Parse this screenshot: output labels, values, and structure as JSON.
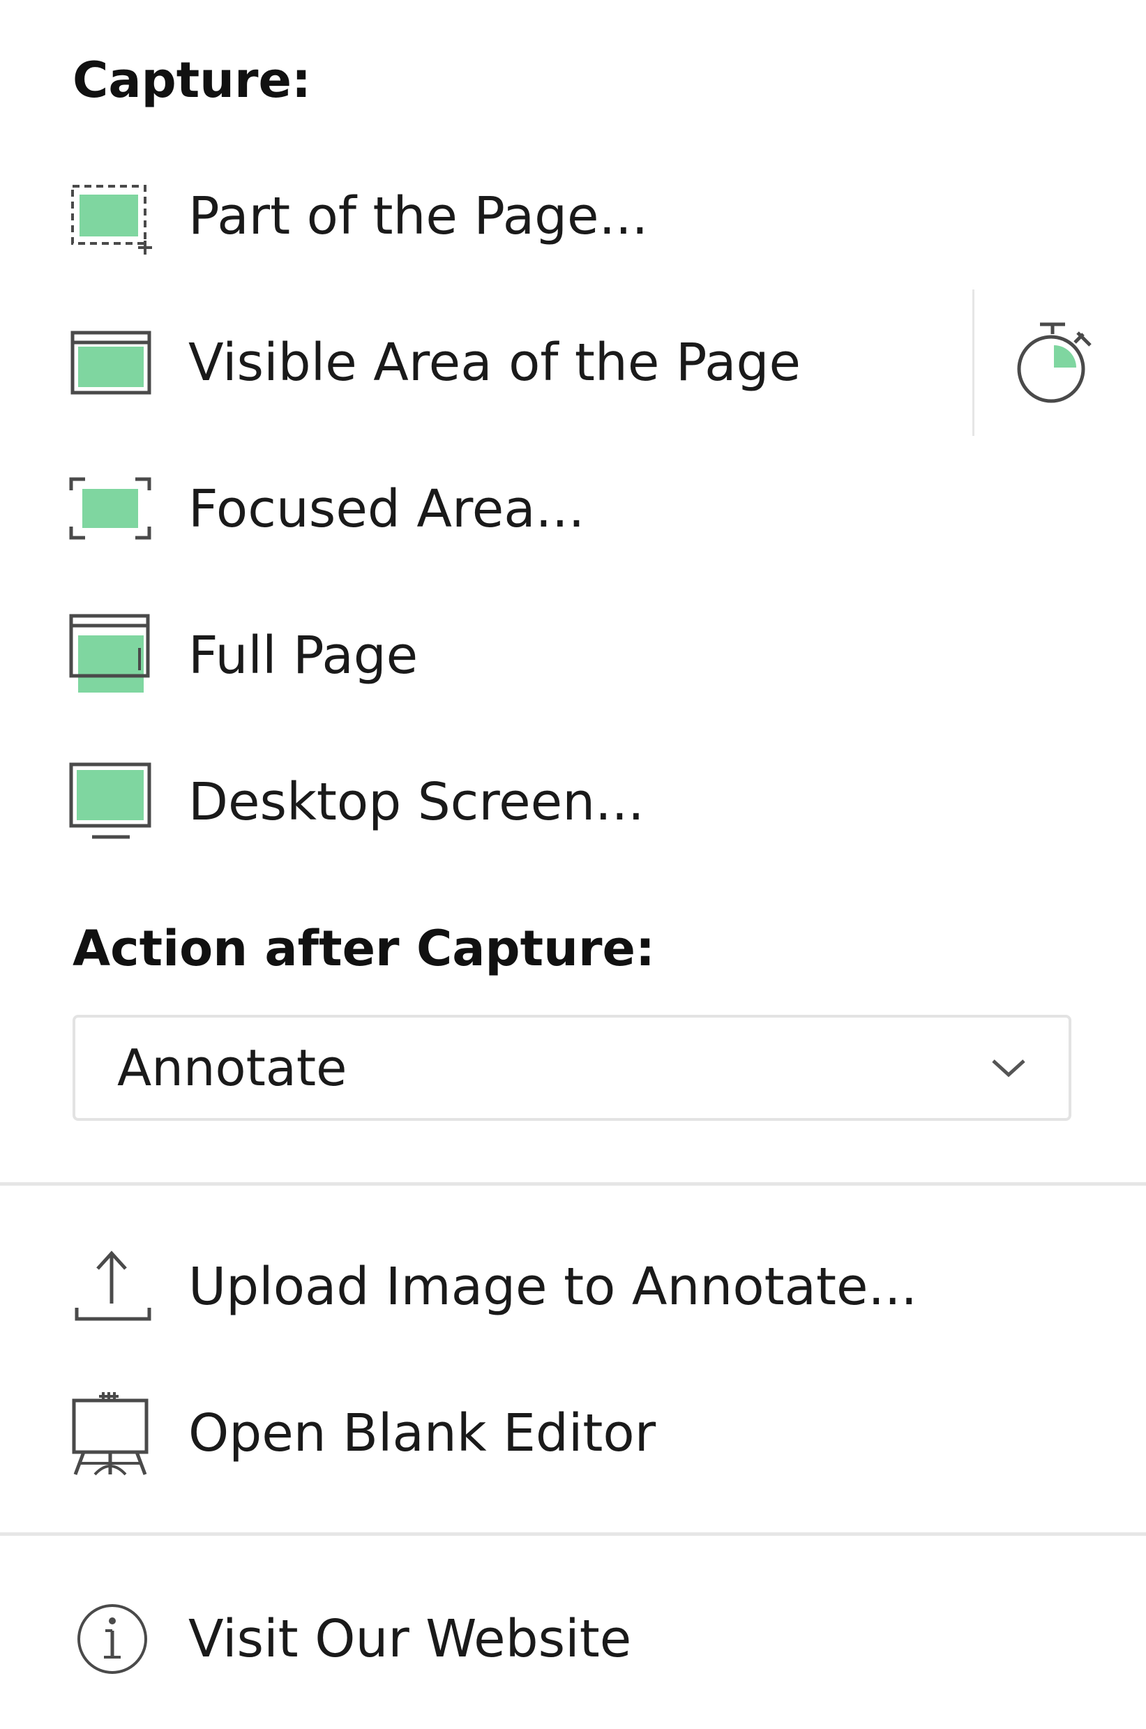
{
  "capture_section": {
    "heading": "Capture:",
    "items": [
      {
        "label": "Part of the Page...",
        "icon": "selection-area-icon"
      },
      {
        "label": "Visible Area of the Page",
        "icon": "browser-window-icon"
      },
      {
        "label": "Focused Area...",
        "icon": "focus-brackets-icon"
      },
      {
        "label": "Full Page",
        "icon": "full-page-icon"
      },
      {
        "label": "Desktop Screen...",
        "icon": "monitor-icon"
      }
    ],
    "timer_icon": "timer-icon"
  },
  "action_section": {
    "heading": "Action after Capture:",
    "selected": "Annotate",
    "dropdown_icon": "chevron-down-icon"
  },
  "tools_section": {
    "items": [
      {
        "label": "Upload Image to Annotate...",
        "icon": "upload-icon"
      },
      {
        "label": "Open Blank Editor",
        "icon": "easel-icon"
      }
    ]
  },
  "footer": {
    "label": "Visit Our Website",
    "icon": "info-icon"
  },
  "colors": {
    "accent_green": "#7fd6a0",
    "icon_stroke": "#4a4a4a",
    "divider": "#e6e6e6"
  }
}
